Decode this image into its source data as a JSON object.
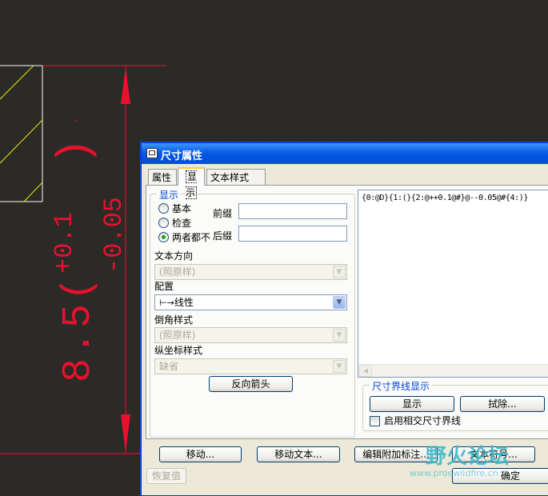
{
  "cad": {
    "dim_main": "8.5(",
    "tol_upper": "+0.1",
    "tol_lower": "-0.05",
    "paren_close": ")"
  },
  "dialog": {
    "title": "尺寸属性",
    "tabs": [
      "属性",
      "显示",
      "文本样式"
    ],
    "display_group": {
      "legend": "显示",
      "radios": [
        {
          "label": "基本",
          "checked": false
        },
        {
          "label": "检查",
          "checked": false
        },
        {
          "label": "两者都不",
          "checked": true
        }
      ],
      "prefix_label": "前缀",
      "prefix_value": "",
      "suffix_label": "后缀",
      "suffix_value": "",
      "text_orientation_label": "文本方向",
      "text_orientation_value": "(照原样)",
      "config_label": "配置",
      "config_value": "线性",
      "chamfer_label": "倒角样式",
      "chamfer_value": "(照原样)",
      "ordinate_label": "纵坐标样式",
      "ordinate_value": "缺省",
      "flip_arrows_button": "反向箭头"
    },
    "format_text": "{0:@D}{1:(}{2:@++0.1@#}@--0.05@#{4:)}",
    "witness_group": {
      "legend": "尺寸界线显示",
      "show_button": "显示",
      "erase_button": "拭除...",
      "intersect_checkbox_label": "启用相交尺寸界线",
      "intersect_checked": false
    },
    "bottom_buttons": {
      "move": "移动...",
      "move_text": "移动文本...",
      "edit_attach": "编辑附加标注...",
      "text_symbol": "文本符号...",
      "restore": "恢复值",
      "ok": "确定"
    }
  },
  "watermark": {
    "text": "野火论坛",
    "url": "www.proewildfire.cn"
  },
  "colors": {
    "cad_background": "#2b2a27",
    "dimension_red": "#e8112d",
    "geometry_white": "#ffffff",
    "hatch_yellow": "#e6e600",
    "xp_title_blue": "#0a5ce6",
    "dialog_face": "#ece9d8",
    "watermark_cyan": "#35b6c8"
  }
}
